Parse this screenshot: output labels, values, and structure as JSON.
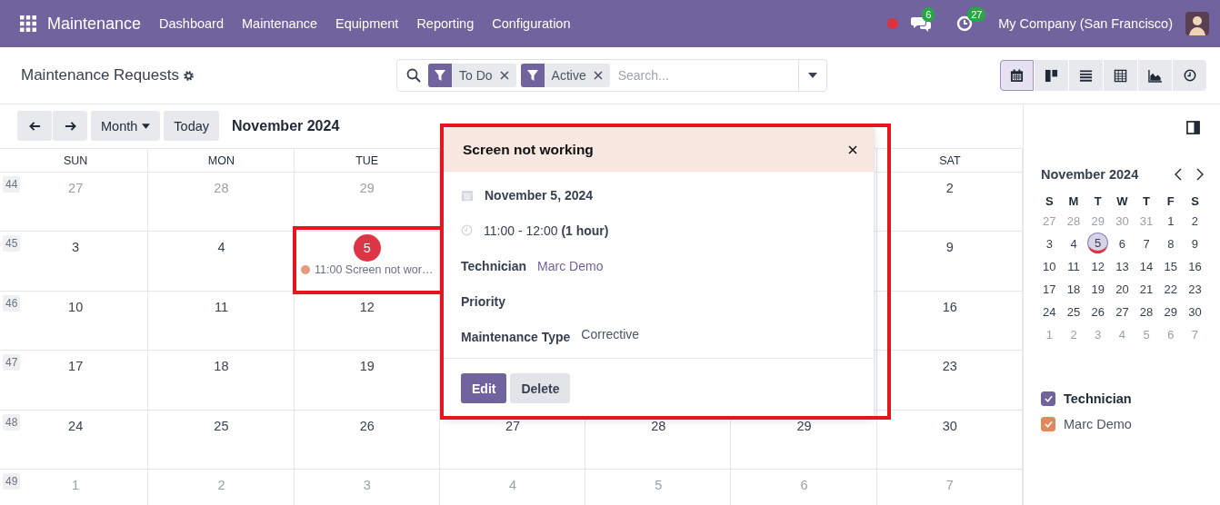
{
  "navbar": {
    "app_name": "Maintenance",
    "menu": [
      "Dashboard",
      "Maintenance",
      "Equipment",
      "Reporting",
      "Configuration"
    ],
    "messages_badge": "6",
    "activities_badge": "27",
    "company": "My Company (San Francisco)"
  },
  "control_panel": {
    "title": "Maintenance Requests",
    "facets": [
      {
        "label": "To Do"
      },
      {
        "label": "Active"
      }
    ],
    "search": {
      "placeholder": "Search..."
    },
    "views": [
      {
        "kind": "calendar",
        "selected": true
      },
      {
        "kind": "kanban",
        "selected": false
      },
      {
        "kind": "list",
        "selected": false
      },
      {
        "kind": "pivot",
        "selected": false
      },
      {
        "kind": "graph",
        "selected": false
      },
      {
        "kind": "activity",
        "selected": false
      }
    ]
  },
  "toolbar": {
    "scale": "Month",
    "today": "Today",
    "period": "November 2024"
  },
  "calendar": {
    "weekdays": [
      "SUN",
      "MON",
      "TUE",
      "SAT"
    ],
    "weeks": [
      {
        "number": "44",
        "days": [
          {
            "label": "27",
            "muted": true,
            "today": false
          },
          {
            "label": "28",
            "muted": true,
            "today": false
          },
          {
            "label": "29",
            "muted": true,
            "today": false
          },
          {
            "label": "2",
            "muted": false,
            "today": false
          }
        ]
      },
      {
        "number": "45",
        "days": [
          {
            "label": "3",
            "muted": false,
            "today": false
          },
          {
            "label": "4",
            "muted": false,
            "today": false
          },
          {
            "label": "5",
            "muted": false,
            "today": true,
            "events": [
              {
                "text": "11:00 Screen not wor…",
                "color": "#e59a7a"
              }
            ]
          },
          {
            "label": "9",
            "muted": false,
            "today": false
          }
        ]
      },
      {
        "number": "46",
        "days": [
          {
            "label": "10",
            "muted": false,
            "today": false
          },
          {
            "label": "11",
            "muted": false,
            "today": false
          },
          {
            "label": "12",
            "muted": false,
            "today": false
          },
          {
            "label": "16",
            "muted": false,
            "today": false
          }
        ]
      },
      {
        "number": "47",
        "days": [
          {
            "label": "17",
            "muted": false,
            "today": false
          },
          {
            "label": "18",
            "muted": false,
            "today": false
          },
          {
            "label": "19",
            "muted": false,
            "today": false
          },
          {
            "label": "23",
            "muted": false,
            "today": false
          }
        ]
      },
      {
        "number": "48",
        "days": [
          {
            "label": "24",
            "muted": false,
            "today": false
          },
          {
            "label": "25",
            "muted": false,
            "today": false
          },
          {
            "label": "26",
            "muted": false,
            "today": false
          },
          {
            "label": "27",
            "muted": false,
            "today": false
          },
          {
            "label": "28",
            "muted": false,
            "today": false
          },
          {
            "label": "29",
            "muted": false,
            "today": false
          },
          {
            "label": "30",
            "muted": false,
            "today": false
          }
        ]
      },
      {
        "number": "49",
        "days": [
          {
            "label": "1",
            "muted": true,
            "today": false
          },
          {
            "label": "2",
            "muted": true,
            "today": false
          },
          {
            "label": "3",
            "muted": true,
            "today": false
          },
          {
            "label": "4",
            "muted": true,
            "today": false
          },
          {
            "label": "5",
            "muted": true,
            "today": false
          },
          {
            "label": "6",
            "muted": true,
            "today": false
          },
          {
            "label": "7",
            "muted": true,
            "today": false
          }
        ]
      }
    ]
  },
  "popover": {
    "title": "Screen not working",
    "date": "November 5, 2024",
    "time": "11:00 - 12:00 **(1 hour)**",
    "fields": [
      {
        "label": "Technician",
        "value": "Marc Demo",
        "kind": "link"
      },
      {
        "label": "Priority",
        "kind": "empty"
      },
      {
        "label": "Maintenance Type",
        "value": "Corrective",
        "kind": "text"
      }
    ],
    "buttons": [
      {
        "label": "Edit",
        "kind": "primary"
      },
      {
        "label": "Delete",
        "kind": "secondary"
      }
    ]
  },
  "mini_calendar": {
    "title": "November 2024",
    "weekdays": [
      "S",
      "M",
      "T",
      "W",
      "T",
      "F",
      "S"
    ],
    "weeks": [
      [
        {
          "label": "27",
          "muted": true,
          "selected": false,
          "today": false
        },
        {
          "label": "28",
          "muted": true,
          "selected": false,
          "today": false
        },
        {
          "label": "29",
          "muted": true,
          "selected": false,
          "today": false
        },
        {
          "label": "30",
          "muted": true,
          "selected": false,
          "today": false
        },
        {
          "label": "31",
          "muted": true,
          "selected": false,
          "today": false
        },
        {
          "label": "1",
          "muted": false,
          "selected": false,
          "today": false
        },
        {
          "label": "2",
          "muted": false,
          "selected": false,
          "today": false
        }
      ],
      [
        {
          "label": "3",
          "muted": false,
          "selected": false,
          "today": false
        },
        {
          "label": "4",
          "muted": false,
          "selected": false,
          "today": false
        },
        {
          "label": "5",
          "muted": false,
          "selected": true,
          "today": true
        },
        {
          "label": "6",
          "muted": false,
          "selected": false,
          "today": false
        },
        {
          "label": "7",
          "muted": false,
          "selected": false,
          "today": false
        },
        {
          "label": "8",
          "muted": false,
          "selected": false,
          "today": false
        },
        {
          "label": "9",
          "muted": false,
          "selected": false,
          "today": false
        }
      ],
      [
        {
          "label": "10",
          "muted": false,
          "selected": false,
          "today": false
        },
        {
          "label": "11",
          "muted": false,
          "selected": false,
          "today": false
        },
        {
          "label": "12",
          "muted": false,
          "selected": false,
          "today": false
        },
        {
          "label": "13",
          "muted": false,
          "selected": false,
          "today": false
        },
        {
          "label": "14",
          "muted": false,
          "selected": false,
          "today": false
        },
        {
          "label": "15",
          "muted": false,
          "selected": false,
          "today": false
        },
        {
          "label": "16",
          "muted": false,
          "selected": false,
          "today": false
        }
      ],
      [
        {
          "label": "17",
          "muted": false,
          "selected": false,
          "today": false
        },
        {
          "label": "18",
          "muted": false,
          "selected": false,
          "today": false
        },
        {
          "label": "19",
          "muted": false,
          "selected": false,
          "today": false
        },
        {
          "label": "20",
          "muted": false,
          "selected": false,
          "today": false
        },
        {
          "label": "21",
          "muted": false,
          "selected": false,
          "today": false
        },
        {
          "label": "22",
          "muted": false,
          "selected": false,
          "today": false
        },
        {
          "label": "23",
          "muted": false,
          "selected": false,
          "today": false
        }
      ],
      [
        {
          "label": "24",
          "muted": false,
          "selected": false,
          "today": false
        },
        {
          "label": "25",
          "muted": false,
          "selected": false,
          "today": false
        },
        {
          "label": "26",
          "muted": false,
          "selected": false,
          "today": false
        },
        {
          "label": "27",
          "muted": false,
          "selected": false,
          "today": false
        },
        {
          "label": "28",
          "muted": false,
          "selected": false,
          "today": false
        },
        {
          "label": "29",
          "muted": false,
          "selected": false,
          "today": false
        },
        {
          "label": "30",
          "muted": false,
          "selected": false,
          "today": false
        }
      ],
      [
        {
          "label": "1",
          "muted": true,
          "selected": false,
          "today": false
        },
        {
          "label": "2",
          "muted": true,
          "selected": false,
          "today": false
        },
        {
          "label": "3",
          "muted": true,
          "selected": false,
          "today": false
        },
        {
          "label": "4",
          "muted": true,
          "selected": false,
          "today": false
        },
        {
          "label": "5",
          "muted": true,
          "selected": false,
          "today": false
        },
        {
          "label": "6",
          "muted": true,
          "selected": false,
          "today": false
        },
        {
          "label": "7",
          "muted": true,
          "selected": false,
          "today": false
        }
      ]
    ]
  },
  "filters": {
    "title": "Technician",
    "checked": true,
    "color": "#71639e",
    "items": [
      {
        "label": "Marc Demo",
        "checked": true,
        "color": "#e08a5c"
      }
    ]
  }
}
